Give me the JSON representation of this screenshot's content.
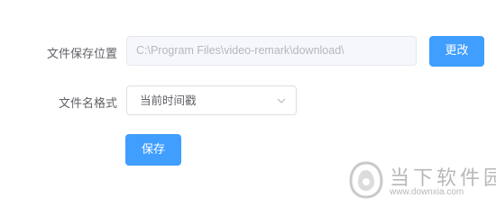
{
  "form": {
    "path_label": "文件保存位置",
    "path_value": "C:\\Program Files\\video-remark\\download\\",
    "change_button": "更改",
    "format_label": "文件名格式",
    "format_selected": "当前时间戳",
    "save_button": "保存"
  },
  "watermark": {
    "brand": "当下软件园",
    "url": "www.downxia.com"
  },
  "colors": {
    "primary": "#409eff",
    "label_text": "#606266",
    "disabled_bg": "#f5f7fa"
  },
  "icons": {
    "select_arrow": "chevron-down-icon",
    "watermark_logo": "downxia-logo-icon"
  }
}
